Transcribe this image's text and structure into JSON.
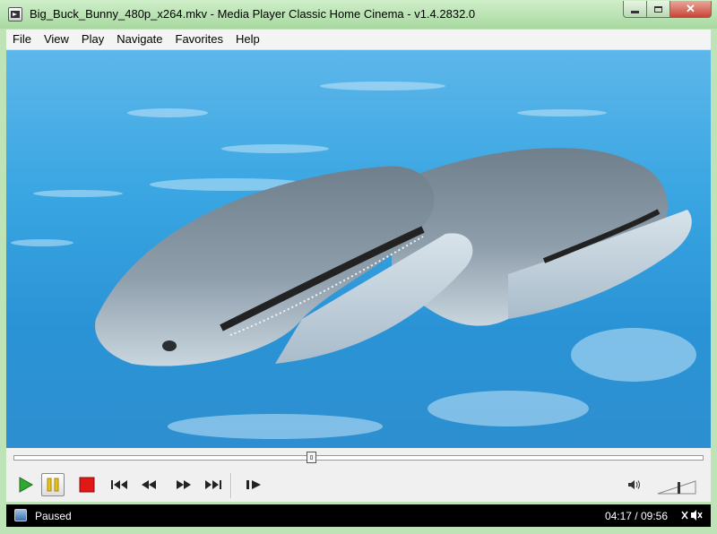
{
  "window": {
    "title": "Big_Buck_Bunny_480p_x264.mkv - Media Player Classic Home Cinema - v1.4.2832.0",
    "close_label": "✕"
  },
  "menu": [
    "File",
    "View",
    "Play",
    "Navigate",
    "Favorites",
    "Help"
  ],
  "playback": {
    "state": "Paused",
    "current_time": "04:17",
    "total_time": "09:56",
    "time_display": "04:17 / 09:56",
    "seek_fraction": 0.431,
    "volume_fraction": 0.55
  },
  "colors": {
    "play": "#2fa82f",
    "pause": "#e6c21a",
    "stop": "#e01818",
    "water": "#2a93d6"
  },
  "icons": {
    "play": "play-icon",
    "pause": "pause-icon",
    "stop": "stop-icon",
    "prev": "skip-back-icon",
    "rew": "rewind-icon",
    "ff": "fast-forward-icon",
    "next": "skip-forward-icon",
    "step": "frame-step-icon",
    "volume": "speaker-icon"
  }
}
